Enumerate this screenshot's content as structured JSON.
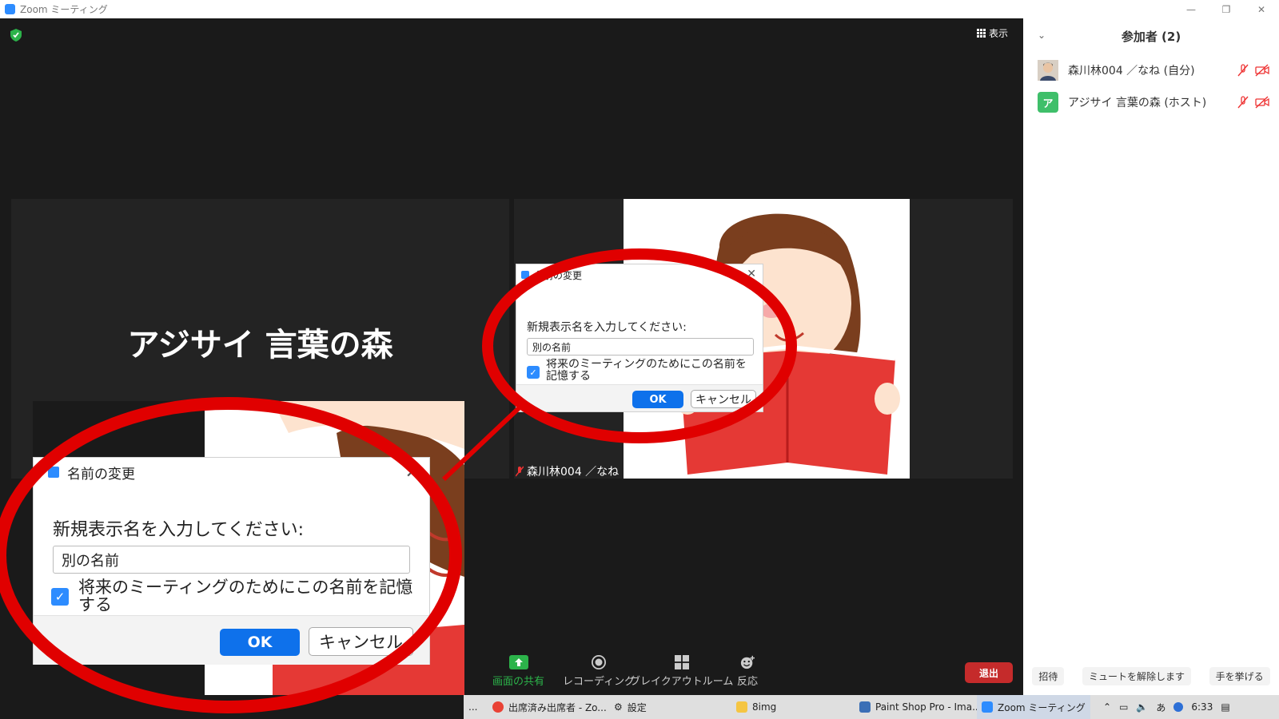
{
  "window": {
    "title": "Zoom ミーティング",
    "controls": [
      "—",
      "❐",
      "✕"
    ]
  },
  "meeting": {
    "view_label": "表示",
    "left_tile_name": "アジサイ 言葉の森",
    "right_tile_label": "森川林004 ／なね"
  },
  "dialog": {
    "title": "名前の変更",
    "prompt": "新規表示名を入力してください:",
    "input_value": "別の名前",
    "remember_label": "将来のミーティングのためにこの名前を記憶する",
    "remember_checked": true,
    "ok_label": "OK",
    "cancel_label": "キャンセル"
  },
  "toolbar": {
    "share": "画面の共有",
    "recording": "レコーディング",
    "breakout": "ブレイクアウトルーム",
    "reactions": "反応",
    "leave": "退出"
  },
  "participants": {
    "title": "参加者 (2)",
    "list": [
      {
        "name": "森川林004 ／なね (自分)",
        "avatar": "photo"
      },
      {
        "name": "アジサイ 言葉の森 (ホスト)",
        "avatar": "ア"
      }
    ],
    "footer": {
      "invite": "招待",
      "unmute": "ミュートを解除します",
      "raise_hand": "手を挙げる"
    }
  },
  "taskbar": {
    "items": [
      "...",
      "出席済み出席者 - Zo...",
      "設定",
      "8img",
      "Paint Shop Pro - Ima...",
      "Zoom ミーティング"
    ],
    "ime": "あ",
    "time": "6:33"
  },
  "colors": {
    "accent": "#0e71eb",
    "share_green": "#2cb34a",
    "leave_red": "#c52b2b",
    "annotation_red": "#e00000",
    "host_avatar_green": "#3fbf6a"
  }
}
